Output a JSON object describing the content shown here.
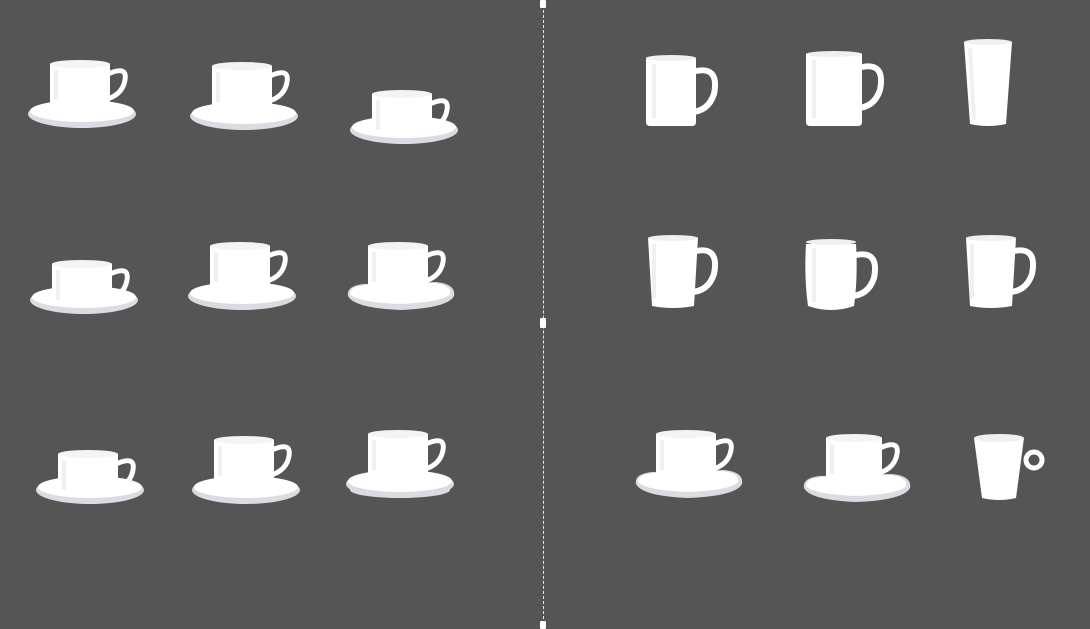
{
  "colors": {
    "background": "#555555",
    "porcelain": "#ffffff",
    "porcelain_shade": "#d9dde2",
    "divider": "#e6e6e6"
  },
  "panels": {
    "left": {
      "items": [
        {
          "name": "cup-with-saucer-1",
          "shape": "cup-saucer",
          "icon": "coffee-cup-icon"
        },
        {
          "name": "cup-with-saucer-2",
          "shape": "cup-saucer",
          "icon": "coffee-cup-icon"
        },
        {
          "name": "cup-with-saucer-3",
          "shape": "cup-saucer-low",
          "icon": "coffee-cup-icon"
        },
        {
          "name": "cup-with-saucer-4",
          "shape": "cup-saucer-low",
          "icon": "coffee-cup-icon"
        },
        {
          "name": "cup-with-saucer-5",
          "shape": "cup-saucer",
          "icon": "coffee-cup-icon"
        },
        {
          "name": "cup-with-saucer-6",
          "shape": "cup-square-saucer",
          "icon": "coffee-cup-icon"
        },
        {
          "name": "cup-with-saucer-7",
          "shape": "cup-saucer-low",
          "icon": "coffee-cup-icon"
        },
        {
          "name": "cup-with-saucer-8",
          "shape": "cup-saucer",
          "icon": "coffee-cup-icon"
        },
        {
          "name": "cup-with-saucer-9",
          "shape": "cup-saucer-stack",
          "icon": "coffee-cup-icon"
        }
      ]
    },
    "right": {
      "items": [
        {
          "name": "mug-1",
          "shape": "mug-small",
          "icon": "mug-icon"
        },
        {
          "name": "mug-2",
          "shape": "mug-large",
          "icon": "mug-icon"
        },
        {
          "name": "tumbler",
          "shape": "tumbler",
          "icon": "tumbler-icon"
        },
        {
          "name": "mug-3",
          "shape": "mug-conical",
          "icon": "mug-icon"
        },
        {
          "name": "mug-4",
          "shape": "mug-barrel",
          "icon": "mug-icon"
        },
        {
          "name": "mug-5",
          "shape": "mug-conical",
          "icon": "mug-icon"
        },
        {
          "name": "cup-with-saucer-10",
          "shape": "cup-square-saucer",
          "icon": "coffee-cup-icon"
        },
        {
          "name": "cup-with-saucer-11",
          "shape": "cup-square-saucer-small",
          "icon": "coffee-cup-icon"
        },
        {
          "name": "cone-cup",
          "shape": "cone-cup",
          "icon": "coffee-cup-icon"
        }
      ]
    }
  }
}
